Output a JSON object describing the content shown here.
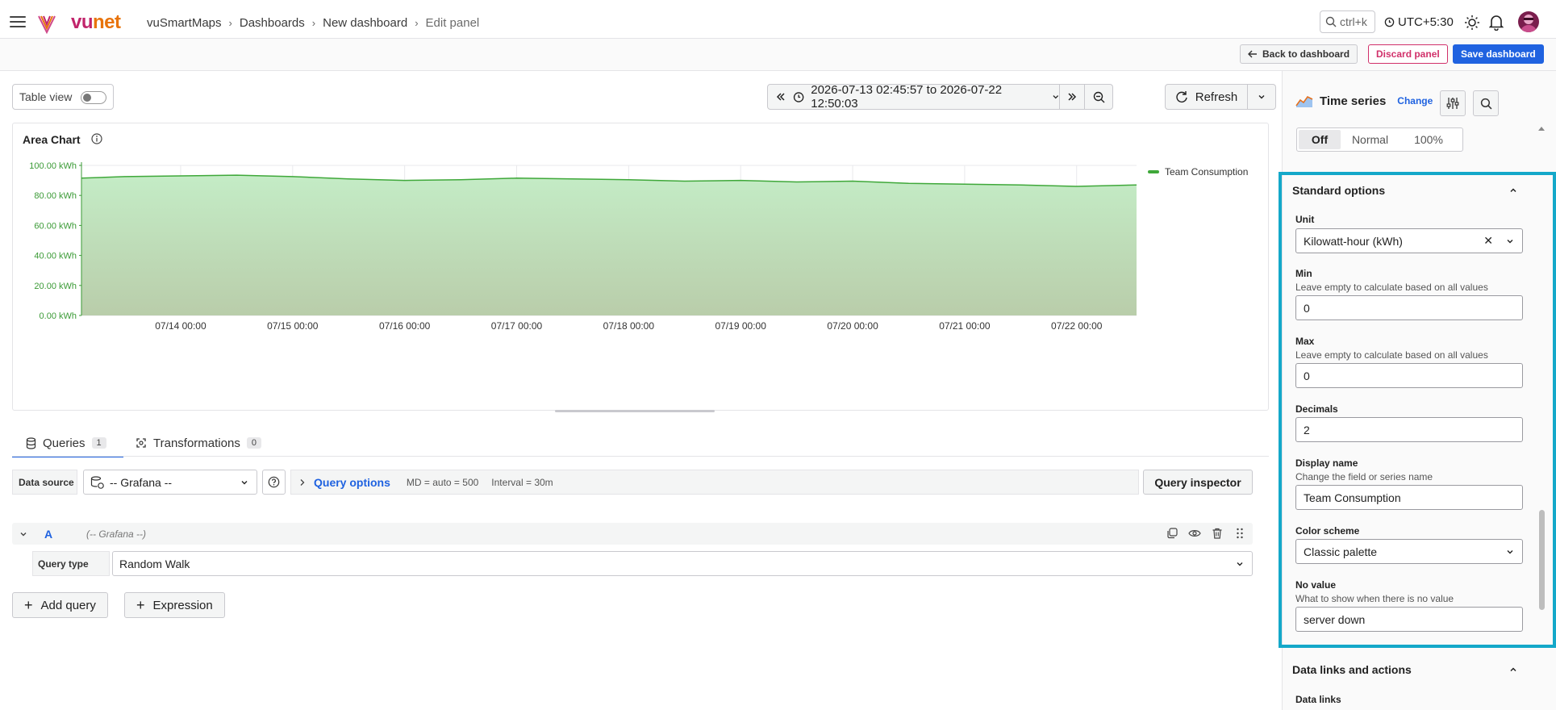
{
  "breadcrumb": [
    "vuSmartMaps",
    "Dashboards",
    "New dashboard",
    "Edit panel"
  ],
  "brand": {
    "part1": "vu",
    "part2": "net"
  },
  "search": {
    "shortcut": "ctrl+k"
  },
  "timezone": "UTC+5:30",
  "actions": {
    "back": "Back to dashboard",
    "discard": "Discard panel",
    "save": "Save dashboard"
  },
  "table_view": {
    "label": "Table view",
    "on": false
  },
  "time_range": "2026-07-13 02:45:57 to 2026-07-22 12:50:03",
  "refresh_label": "Refresh",
  "panel": {
    "title": "Area Chart"
  },
  "chart_data": {
    "type": "area",
    "title": "Area Chart",
    "xlabel": "",
    "ylabel": "",
    "ylim": [
      0,
      100
    ],
    "y_ticks": [
      "0.00 kWh",
      "20.00 kWh",
      "40.00 kWh",
      "60.00 kWh",
      "80.00 kWh",
      "100.00 kWh"
    ],
    "x_ticks": [
      "07/14 00:00",
      "07/15 00:00",
      "07/16 00:00",
      "07/17 00:00",
      "07/18 00:00",
      "07/19 00:00",
      "07/20 00:00",
      "07/21 00:00",
      "07/22 00:00"
    ],
    "series": [
      {
        "name": "Team Consumption",
        "color": "#3fa83a",
        "x": [
          "2026-07-13 02:45",
          "2026-07-13 12:00",
          "2026-07-14 00:00",
          "2026-07-14 12:00",
          "2026-07-15 00:00",
          "2026-07-15 12:00",
          "2026-07-16 00:00",
          "2026-07-16 12:00",
          "2026-07-17 00:00",
          "2026-07-17 12:00",
          "2026-07-18 00:00",
          "2026-07-18 12:00",
          "2026-07-19 00:00",
          "2026-07-19 12:00",
          "2026-07-20 00:00",
          "2026-07-20 12:00",
          "2026-07-21 00:00",
          "2026-07-21 12:00",
          "2026-07-22 00:00",
          "2026-07-22 12:50"
        ],
        "values": [
          91.5,
          92.5,
          93.0,
          93.5,
          92.5,
          91.0,
          90.0,
          90.5,
          91.5,
          91.0,
          90.5,
          89.5,
          90.0,
          89.0,
          89.5,
          88.0,
          87.5,
          87.0,
          86.0,
          87.0
        ]
      }
    ]
  },
  "legend": [
    "Team Consumption"
  ],
  "tabs": [
    {
      "label": "Queries",
      "count": "1"
    },
    {
      "label": "Transformations",
      "count": "0"
    }
  ],
  "query": {
    "datasource_label": "Data source",
    "datasource_value": "-- Grafana --",
    "options_title": "Query options",
    "md": "MD = auto = 500",
    "interval": "Interval = 30m",
    "inspector": "Query inspector",
    "letter": "A",
    "letter_sub": "(-- Grafana --)",
    "type_label": "Query type",
    "type_value": "Random Walk",
    "add_query": "Add query",
    "expression": "Expression"
  },
  "viz": {
    "name": "Time series",
    "change": "Change"
  },
  "stacking": {
    "options": [
      "Off",
      "Normal",
      "100%"
    ],
    "selected": "Off"
  },
  "standard": {
    "header": "Standard options",
    "unit_label": "Unit",
    "unit_value": "Kilowatt-hour (kWh)",
    "min_label": "Min",
    "min_desc": "Leave empty to calculate based on all values",
    "min_value": "0",
    "max_label": "Max",
    "max_desc": "Leave empty to calculate based on all values",
    "max_value": "0",
    "decimals_label": "Decimals",
    "decimals_value": "2",
    "display_label": "Display name",
    "display_desc": "Change the field or series name",
    "display_value": "Team Consumption",
    "color_label": "Color scheme",
    "color_value": "Classic palette",
    "novalue_label": "No value",
    "novalue_desc": "What to show when there is no value",
    "novalue_value": "server down"
  },
  "links": {
    "header": "Data links and actions",
    "sub": "Data links"
  }
}
